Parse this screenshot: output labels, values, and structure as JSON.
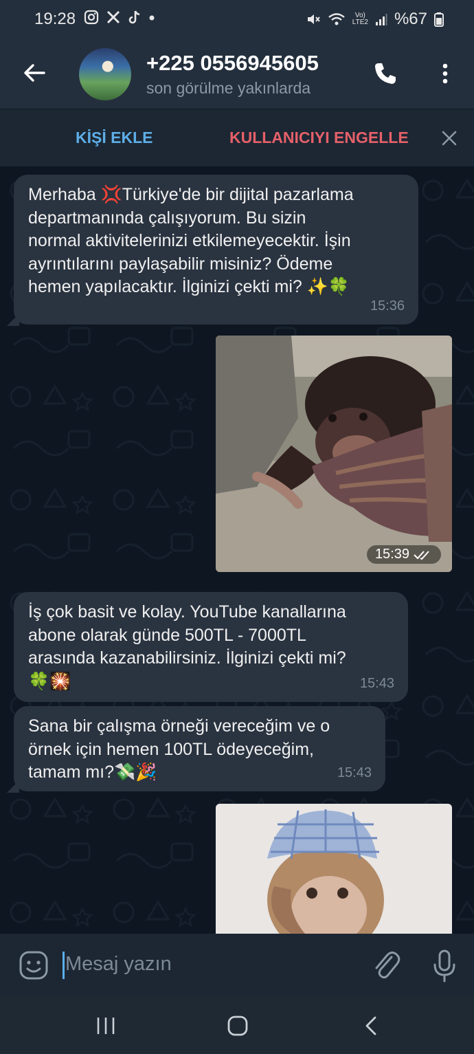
{
  "status_bar": {
    "time": "19:28",
    "network_top": "Vo)",
    "network_bottom": "LTE2",
    "battery": "%67",
    "icons_left": [
      "instagram-icon",
      "x-icon",
      "tiktok-icon",
      "dot-icon"
    ],
    "icons_right": [
      "mute-icon",
      "wifi-icon",
      "signal-icon",
      "battery-icon"
    ]
  },
  "header": {
    "contact_name": "+225 0556945605",
    "contact_status": "son görülme yakınlarda"
  },
  "action_bar": {
    "add_contact": "KİŞİ EKLE",
    "block_user": "KULLANICIYI ENGELLE"
  },
  "messages": [
    {
      "type": "text",
      "direction": "incoming",
      "text": "Merhaba  💢Türkiye'de bir dijital pazarlama\ndepartmanında çalışıyorum. Bu sizin\nnormal aktivitelerinizi etkilemeyecektir. İşin\nayrıntılarını paylaşabilir misiniz? Ödeme\nhemen yapılacaktır. İlginizi çekti mi?  ✨🍀",
      "time": "15:36"
    },
    {
      "type": "image",
      "direction": "outgoing",
      "subject": "chimpanzee",
      "time": "15:39",
      "read_icon": "double-check-icon"
    },
    {
      "type": "text",
      "direction": "incoming",
      "text": "İş çok basit ve kolay. YouTube kanallarına\nabone olarak günde 500TL - 7000TL\narasında kazanabilirsiniz. İlginizi çekti mi?\n🍀🎇",
      "time": "15:43"
    },
    {
      "type": "text",
      "direction": "incoming",
      "text": "Sana bir çalışma örneği vereceğim ve o\nörnek için hemen 100TL  ödeyeceğim,\ntamam mı?💸🎉",
      "time": "15:43"
    },
    {
      "type": "image",
      "direction": "outgoing",
      "subject": "monkey-in-hat"
    }
  ],
  "input_bar": {
    "placeholder": "Mesaj yazın"
  },
  "colors": {
    "accent": "#5eaee8",
    "danger": "#e6606a",
    "bubble_in": "#2a3340",
    "chat_bg": "#0e1621",
    "header_bg": "#242f3d"
  }
}
